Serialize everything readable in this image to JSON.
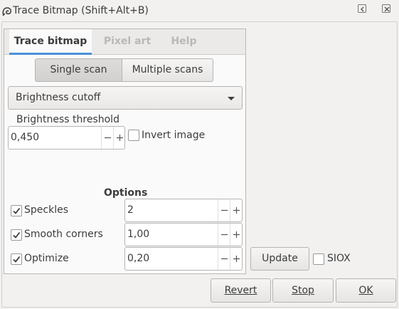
{
  "window": {
    "title": "Trace Bitmap (Shift+Alt+B)"
  },
  "tabs": [
    {
      "label": "Trace bitmap",
      "active": true
    },
    {
      "label": "Pixel art",
      "active": false
    },
    {
      "label": "Help",
      "active": false
    }
  ],
  "scan_mode": {
    "single": "Single scan",
    "multiple": "Multiple scans",
    "selected": "Single scan"
  },
  "mode_combo": {
    "value": "Brightness cutoff"
  },
  "threshold": {
    "label": "Brightness threshold",
    "value": "0,450"
  },
  "invert": {
    "label": "Invert image",
    "checked": false
  },
  "options": {
    "title": "Options",
    "speckles": {
      "label": "Speckles",
      "checked": true,
      "value": "2"
    },
    "smooth_corners": {
      "label": "Smooth corners",
      "checked": true,
      "value": "1,00"
    },
    "optimize": {
      "label": "Optimize",
      "checked": true,
      "value": "0,20"
    }
  },
  "preview": {
    "update_label": "Update",
    "siox_label": "SIOX",
    "siox_checked": false
  },
  "actions": {
    "revert": "Revert",
    "stop": "Stop",
    "ok": "OK"
  },
  "colors": {
    "accent": "#4a90d9",
    "background": "#f2f1f0",
    "text": "#3c3c3c"
  }
}
